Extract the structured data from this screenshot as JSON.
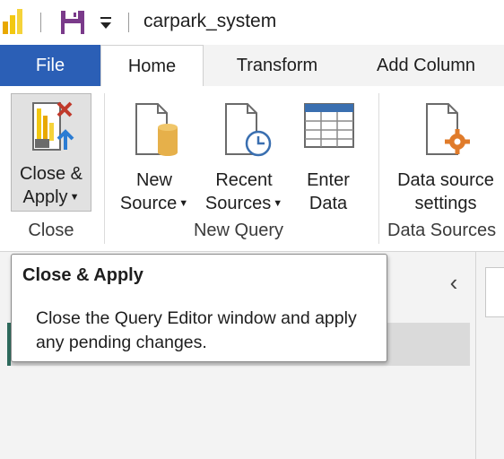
{
  "titlebar": {
    "title": "carpark_system",
    "icons": [
      "power-bi-logo",
      "save-icon",
      "customize-quick-access-icon"
    ]
  },
  "tabs": {
    "file": "File",
    "home": "Home",
    "transform": "Transform",
    "add_column": "Add Column",
    "active": "Home"
  },
  "ribbon": {
    "close_apply": {
      "line1": "Close &",
      "line2": "Apply",
      "dropdown": true,
      "icon": "close-apply-icon"
    },
    "new_source": {
      "line1": "New",
      "line2": "Source",
      "dropdown": true,
      "icon": "new-source-icon"
    },
    "recent_sources": {
      "line1": "Recent",
      "line2": "Sources",
      "dropdown": true,
      "icon": "recent-sources-icon"
    },
    "enter_data": {
      "line1": "Enter",
      "line2": "Data",
      "icon": "table-icon"
    },
    "data_source_settings": {
      "line1": "Data source",
      "line2": "settings",
      "icon": "data-source-settings-icon"
    },
    "groups": {
      "close": "Close",
      "new_query": "New Query",
      "data_sources": "Data Sources"
    }
  },
  "tooltip": {
    "title": "Close & Apply",
    "body": "Close the Query Editor window and apply any pending changes."
  },
  "colors": {
    "file_tab": "#2b5fb6",
    "accent": "#2f6b5e",
    "logo_yellow": "#f2c811",
    "save_purple": "#7a3a8a",
    "close_red": "#c0392b",
    "apply_blue": "#2b7cd3",
    "gear_orange": "#e07b2a",
    "table_blue": "#3a6fb0"
  }
}
